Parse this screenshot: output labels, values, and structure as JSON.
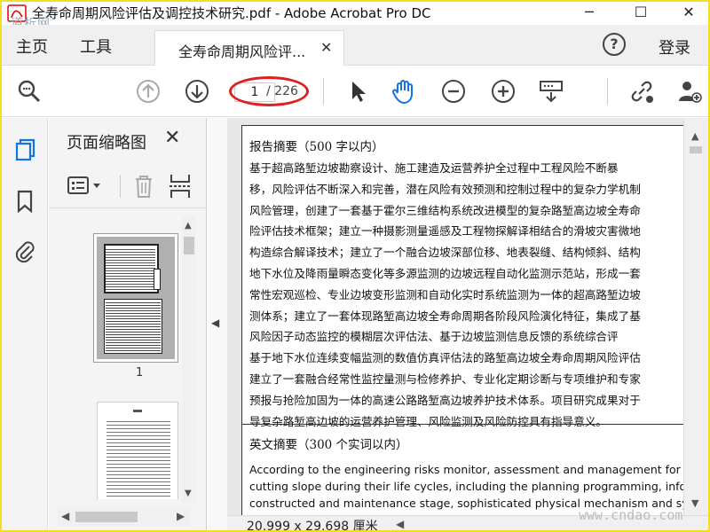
{
  "window": {
    "title": "全寿命周期风险评估及调控技术研究.pdf - Adobe Acrobat Pro DC",
    "minimize": "─",
    "maximize": "☐",
    "close": "✕",
    "watermark_tl": "道析网"
  },
  "menu": {
    "home": "主页",
    "tools": "工具",
    "tab_label": "全寿命周期风险评...",
    "tab_close": "✕",
    "help": "?",
    "login": "登录"
  },
  "toolbar": {
    "current_page": "1",
    "total_pages": "/ 226"
  },
  "panel": {
    "title": "页面缩略图",
    "close": "✕",
    "thumb1_label": "1"
  },
  "document": {
    "cn_heading": "报告摘要（500 字以内）",
    "cn_lines": [
      "        基于超高路堑边坡勘察设计、施工建造及运营养护全过程中工程风险不断暴",
      "移，风险评估不断深入和完善，潜在风险有效预测和控制过程中的复杂力学机制",
      "风险管理，创建了一套基于霍尔三维结构系统改进模型的复杂路堑高边坡全寿命",
      "险评估技术框架；建立一种摄影测量遥感及工程物探解译相结合的滑坡灾害微地",
      "构造综合解译技术；建立了一个融合边坡深部位移、地表裂缝、结构倾斜、结构",
      "地下水位及降雨量瞬态变化等多源监测的边坡远程自动化监测示范站，形成一套",
      "常性宏观巡检、专业边坡变形监测和自动化实时系统监测为一体的超高路堑边坡",
      "测体系；建立了一套体现路堑高边坡全寿命周期各阶段风险演化特征，集成了基",
      "风险因子动态监控的模糊层次评估法、基于边坡监测信息反馈的系统综合评",
      "基于地下水位连续变幅监测的数值仿真评估法的路堑高边坡全寿命周期风险评估",
      "建立了一套融合经常性监控量测与检修养护、专业化定期诊断与专项维护和专家",
      "预报与抢险加固为一体的高速公路路堑高边坡养护技术体系。项目研究成果对于",
      "导复杂路堑高边坡的运营养护管理、风险监测及风险防控具有指导意义。"
    ],
    "en_heading": "英文摘要（300 个实词以内）",
    "en_lines": [
      "According to the engineering risks monitor, assessment and management for the sup",
      "cutting slope during their life cycles, including the planning programming, inform",
      "constructed and maintenance stage, sophisticated physical mechanism and system"
    ]
  },
  "status": {
    "page_size": "20.999 x 29.698 厘米",
    "watermark_br": "www.cndao.com"
  },
  "colors": {
    "accent_blue": "#1473e6",
    "frame_yellow": "#f0e020",
    "annotation_red": "#e02020"
  }
}
